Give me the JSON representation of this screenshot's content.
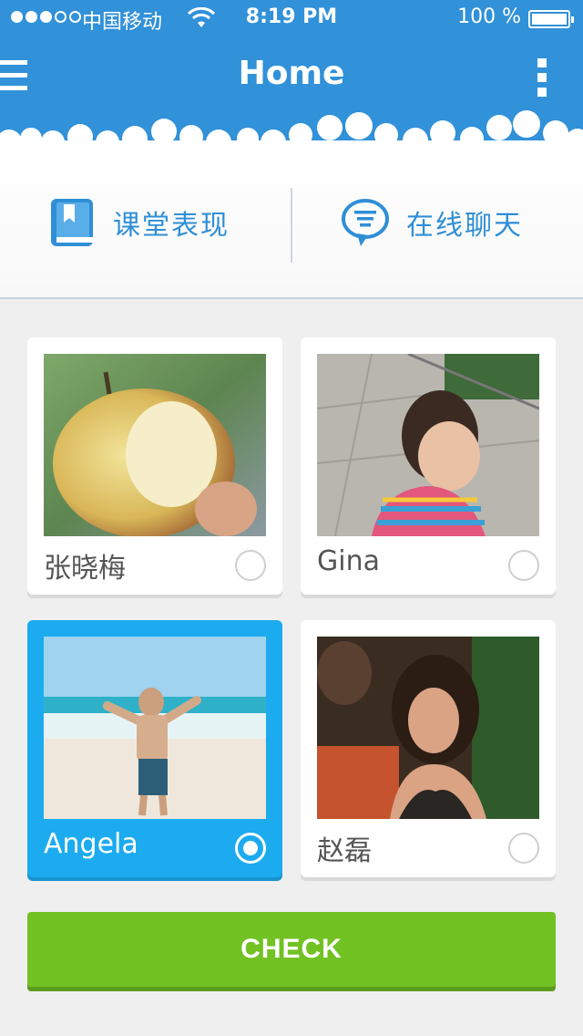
{
  "status_bar": {
    "carrier": "中国移动",
    "time": "8:19 PM",
    "battery": "100 %",
    "signal_bars_on": 3,
    "signal_bars_total": 5,
    "battery_level": 1.0
  },
  "header": {
    "title": "Home",
    "menu_icon": "hamburger-menu-icon",
    "more_icon": "vertical-dots-icon"
  },
  "tabs": [
    {
      "label": "课堂表现",
      "icon": "book-icon"
    },
    {
      "label": "在线聊天",
      "icon": "chat-bubble-icon"
    }
  ],
  "students": [
    {
      "name": "张晓梅",
      "photo": "bitten-apple-photo",
      "selected": false
    },
    {
      "name": "Gina",
      "photo": "girl-photo",
      "selected": false
    },
    {
      "name": "Angela",
      "photo": "boy-on-beach-photo",
      "selected": true
    },
    {
      "name": "赵磊",
      "photo": "smiling-woman-photo",
      "selected": false
    }
  ],
  "check_button": {
    "label": "CHECK"
  },
  "colors": {
    "header_blue": "#3191d9",
    "tab_text_blue": "#2f8fd6",
    "selected_card": "#1cabef",
    "check_green": "#72c224",
    "background": "#efefef"
  }
}
